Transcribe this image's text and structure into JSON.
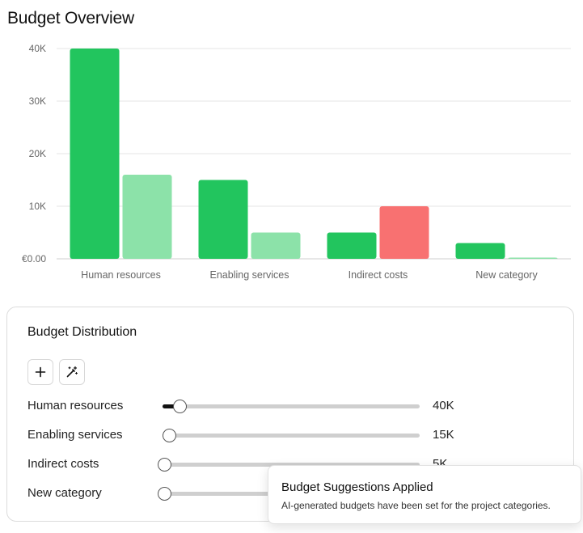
{
  "page": {
    "title": "Budget Overview"
  },
  "chart_data": {
    "type": "bar",
    "categories": [
      "Human resources",
      "Enabling services",
      "Indirect costs",
      "New category"
    ],
    "series": [
      {
        "values": [
          40000,
          15000,
          5000,
          3000
        ],
        "colors": [
          "#22c55e",
          "#22c55e",
          "#22c55e",
          "#22c55e"
        ]
      },
      {
        "values": [
          16000,
          5000,
          10000,
          0
        ],
        "colors": [
          "#8ce2a9",
          "#8ce2a9",
          "#f87171",
          "#8ce2a9"
        ]
      }
    ],
    "yticks": [
      {
        "value": 0,
        "label": "€0.00"
      },
      {
        "value": 10000,
        "label": "10K"
      },
      {
        "value": 20000,
        "label": "20K"
      },
      {
        "value": 30000,
        "label": "30K"
      },
      {
        "value": 40000,
        "label": "40K"
      }
    ],
    "ylim": [
      0,
      40000
    ],
    "grid": true,
    "legend": "none"
  },
  "distribution": {
    "title": "Budget Distribution",
    "add_button_icon": "plus-icon",
    "magic_button_icon": "magic-wand-icon",
    "rows": [
      {
        "label": "Human resources",
        "value": "40K",
        "slider_fraction": 0.065
      },
      {
        "label": "Enabling services",
        "value": "15K",
        "slider_fraction": 0.025
      },
      {
        "label": "Indirect costs",
        "value": "5K",
        "slider_fraction": 0.005
      },
      {
        "label": "New category",
        "value": "",
        "slider_fraction": 0.005
      }
    ]
  },
  "toast": {
    "title": "Budget Suggestions Applied",
    "description": "AI-generated budgets have been set for the project categories."
  },
  "colors": {
    "primary_green": "#22c55e",
    "light_green": "#8ce2a9",
    "red": "#f87171",
    "grid": "#e5e5e5"
  }
}
